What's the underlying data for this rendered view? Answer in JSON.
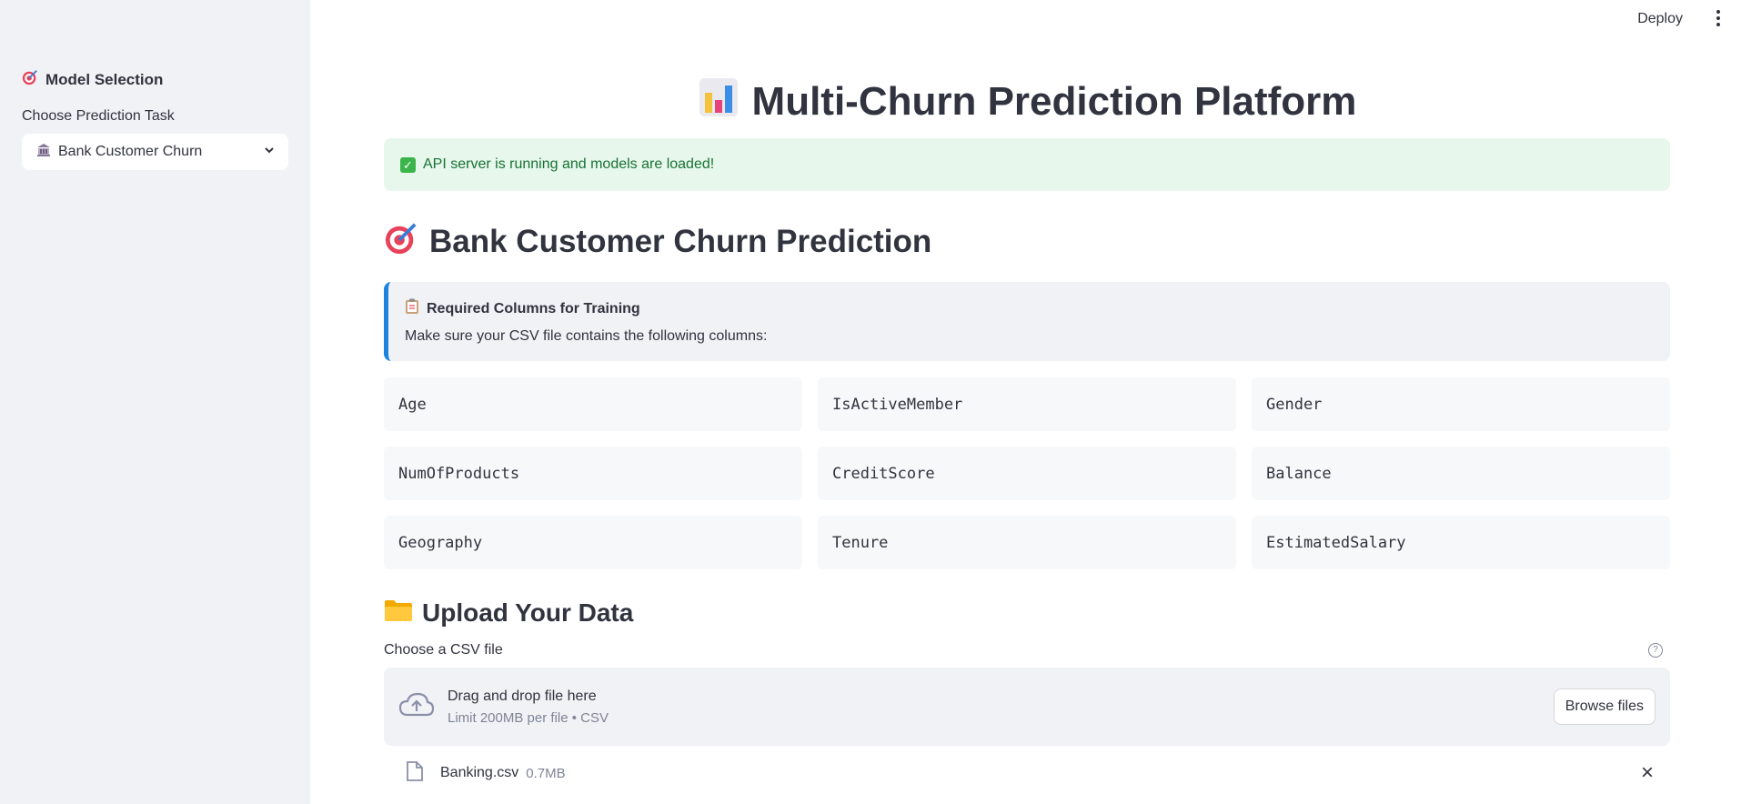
{
  "sidebar": {
    "heading": "Model Selection",
    "heading_icon": "target-icon",
    "select_label": "Choose Prediction Task",
    "selected_option": "Bank Customer Churn",
    "selected_icon": "bank-icon"
  },
  "topbar": {
    "deploy_label": "Deploy",
    "menu_icon": "kebab-menu-icon"
  },
  "main": {
    "title": "Multi-Churn Prediction Platform",
    "title_icon": "bar-chart-icon",
    "status_message": "API server is running and models are loaded!",
    "section_title": "Bank Customer Churn Prediction",
    "section_icon": "target-icon",
    "info_title": "Required Columns for Training",
    "info_icon": "clipboard-icon",
    "info_body": "Make sure your CSV file contains the following columns:",
    "columns": [
      "Age",
      "IsActiveMember",
      "Gender",
      "NumOfProducts",
      "CreditScore",
      "Balance",
      "Geography",
      "Tenure",
      "EstimatedSalary"
    ],
    "upload_title": "Upload Your Data",
    "upload_icon": "folder-icon",
    "upload_label": "Choose a CSV file",
    "dropzone_text": "Drag and drop file here",
    "dropzone_limit": "Limit 200MB per file • CSV",
    "browse_label": "Browse files",
    "file": {
      "name": "Banking.csv",
      "size": "0.7MB"
    }
  },
  "colors": {
    "sidebar_bg": "#f0f2f6",
    "success_bg": "#e8f7ec",
    "success_text": "#177233",
    "info_border": "#1c83e1",
    "text": "#31333f"
  }
}
